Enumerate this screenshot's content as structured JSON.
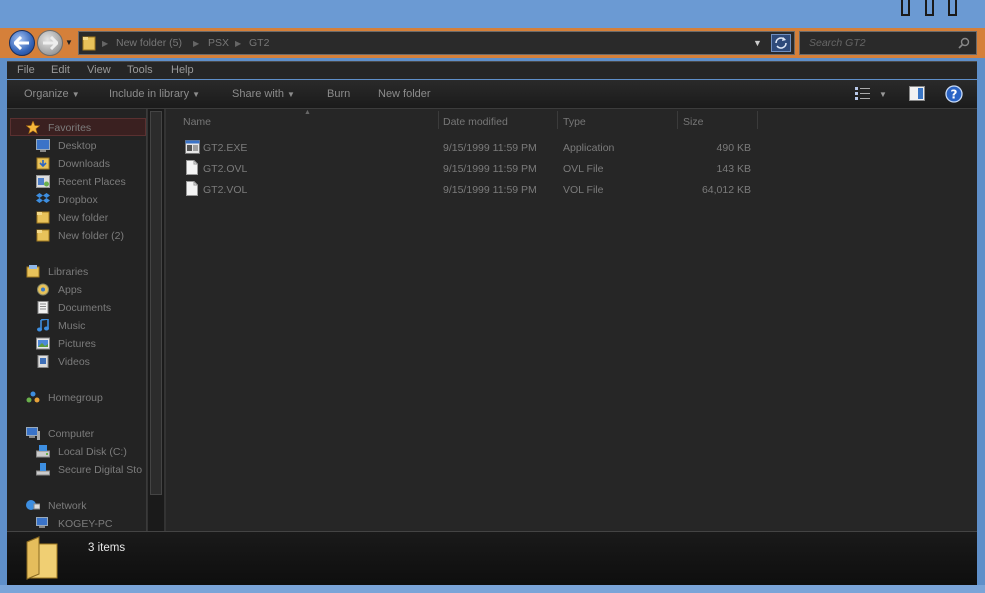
{
  "address": {
    "crumbs": [
      "New folder (5)",
      "PSX",
      "GT2"
    ]
  },
  "search": {
    "placeholder": "Search GT2"
  },
  "menu": [
    "File",
    "Edit",
    "View",
    "Tools",
    "Help"
  ],
  "toolbar": {
    "organize": "Organize",
    "include": "Include in library",
    "share": "Share with",
    "burn": "Burn",
    "new_folder": "New folder"
  },
  "nav": {
    "favorites": "Favorites",
    "fav_items": [
      "Desktop",
      "Downloads",
      "Recent Places",
      "Dropbox",
      "New folder",
      "New folder (2)"
    ],
    "libraries": "Libraries",
    "lib_items": [
      "Apps",
      "Documents",
      "Music",
      "Pictures",
      "Videos"
    ],
    "homegroup": "Homegroup",
    "computer": "Computer",
    "comp_items": [
      "Local Disk (C:)",
      "Secure Digital Sto"
    ],
    "network": "Network",
    "net_items": [
      "KOGEY-PC"
    ]
  },
  "columns": {
    "name": "Name",
    "date": "Date modified",
    "type": "Type",
    "size": "Size"
  },
  "files": [
    {
      "name": "GT2.EXE",
      "date": "9/15/1999 11:59 PM",
      "type": "Application",
      "size": "490 KB",
      "icon": "application-icon"
    },
    {
      "name": "GT2.OVL",
      "date": "9/15/1999 11:59 PM",
      "type": "OVL File",
      "size": "143 KB",
      "icon": "file-icon"
    },
    {
      "name": "GT2.VOL",
      "date": "9/15/1999 11:59 PM",
      "type": "VOL File",
      "size": "64,012 KB",
      "icon": "file-icon"
    }
  ],
  "status": {
    "count": "3 items"
  }
}
